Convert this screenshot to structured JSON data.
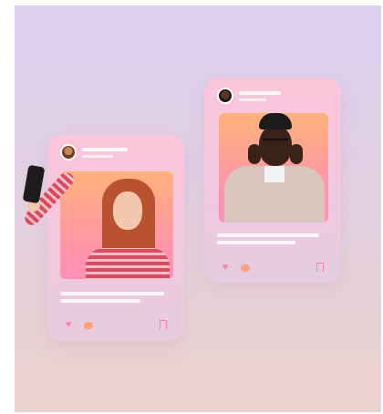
{
  "scene": {
    "background_gradient": [
      "#dccff0",
      "#e2d0e2",
      "#ecd2cc"
    ],
    "accent_pink": "#ff7eb0",
    "accent_orange": "#ffa07e"
  },
  "cards": [
    {
      "id": "left",
      "photo_subject": "woman-taking-selfie",
      "icons": [
        "avatar-icon",
        "heart-icon",
        "comment-icon",
        "bookmark-icon"
      ]
    },
    {
      "id": "right",
      "photo_subject": "man-with-glasses-and-beanie",
      "icons": [
        "avatar-icon",
        "heart-icon",
        "comment-icon",
        "bookmark-icon"
      ]
    }
  ]
}
